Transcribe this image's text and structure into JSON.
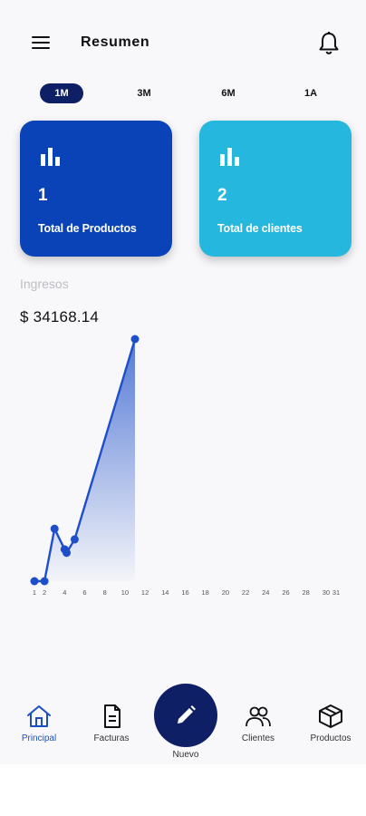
{
  "header": {
    "title": "Resumen",
    "menu_icon": "hamburger-menu-icon",
    "notification_icon": "bell-icon"
  },
  "periods": [
    {
      "label": "1M",
      "active": true
    },
    {
      "label": "3M",
      "active": false
    },
    {
      "label": "6M",
      "active": false
    },
    {
      "label": "1A",
      "active": false
    }
  ],
  "cards": {
    "products": {
      "value": "1",
      "label": "Total de Productos",
      "color": "#0a43b8",
      "icon": "bar-chart-icon"
    },
    "clients": {
      "value": "2",
      "label": "Total de clientes",
      "color": "#26b7de",
      "icon": "bar-chart-icon"
    }
  },
  "income": {
    "label": "Ingresos",
    "value": "$ 34168.14"
  },
  "chart_data": {
    "type": "area",
    "x_ticks": [
      "1",
      "2",
      "4",
      "6",
      "8",
      "10",
      "12",
      "14",
      "16",
      "18",
      "20",
      "22",
      "24",
      "26",
      "28",
      "30",
      "31"
    ],
    "x": [
      1,
      2,
      3,
      4,
      4.2,
      5,
      11
    ],
    "y": [
      0,
      0,
      7400,
      4500,
      4000,
      5900,
      34168.14
    ],
    "ylim": [
      0,
      34168.14
    ],
    "line_color": "#1e4fc9",
    "title": "",
    "xlabel": "",
    "ylabel": ""
  },
  "nav": {
    "items": [
      {
        "label": "Principal",
        "icon": "home-icon",
        "active": true
      },
      {
        "label": "Facturas",
        "icon": "invoice-icon",
        "active": false
      },
      {
        "label": "Nuevo",
        "icon": "pencil-icon",
        "active": false
      },
      {
        "label": "Clientes",
        "icon": "people-icon",
        "active": false
      },
      {
        "label": "Productos",
        "icon": "box-icon",
        "active": false
      }
    ]
  }
}
